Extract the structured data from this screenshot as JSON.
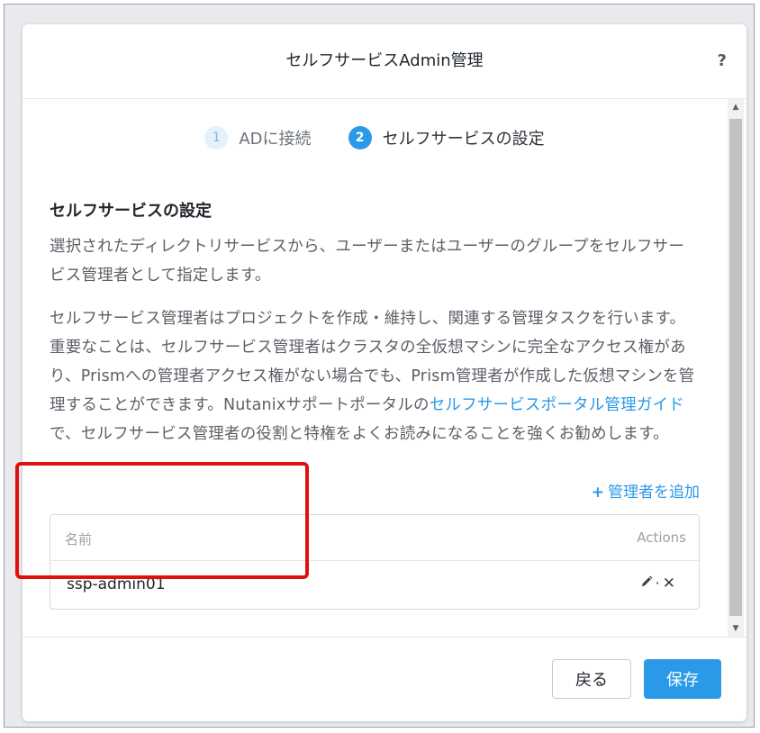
{
  "dialog": {
    "title": "セルフサービスAdmin管理",
    "help_label": "?"
  },
  "steps": [
    {
      "number": "1",
      "label": "ADに接続"
    },
    {
      "number": "2",
      "label": "セルフサービスの設定"
    }
  ],
  "section": {
    "title": "セルフサービスの設定",
    "para1": "選択されたディレクトリサービスから、ユーザーまたはユーザーのグループをセルフサービス管理者として指定します。",
    "para2_before": "セルフサービス管理者はプロジェクトを作成・維持し、関連する管理タスクを行います。重要なことは、セルフサービス管理者はクラスタの全仮想マシンに完全なアクセス権があり、Prismへの管理者アクセス権がない場合でも、Prism管理者が作成した仮想マシンを管理することができます。Nutanixサポートポータルの",
    "para2_link": "セルフサービスポータル管理ガイド",
    "para2_after": "で、セルフサービス管理者の役割と特権をよくお読みになることを強くお勧めします。"
  },
  "add_admin": {
    "plus": "+",
    "label": "管理者を追加"
  },
  "table": {
    "headers": {
      "name": "名前",
      "actions": "Actions"
    },
    "rows": [
      {
        "name": "ssp-admin01"
      }
    ],
    "row_separator": "·",
    "delete_glyph": "✕"
  },
  "footer": {
    "back_label": "戻る",
    "save_label": "保存"
  },
  "colors": {
    "accent": "#2a9ae8",
    "highlight": "#e01010"
  }
}
